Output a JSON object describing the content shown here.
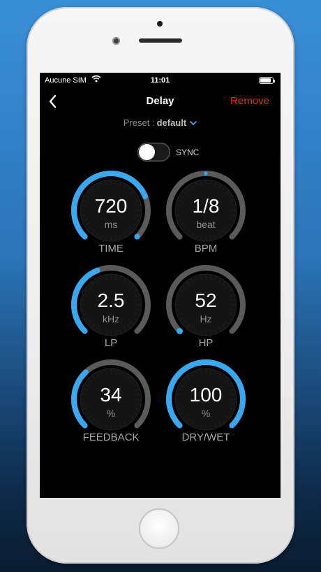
{
  "statusbar": {
    "carrier": "Aucune SIM",
    "time": "11:01"
  },
  "nav": {
    "title": "Delay",
    "remove_label": "Remove"
  },
  "preset": {
    "prefix": "Preset :",
    "value": "default"
  },
  "sync": {
    "label": "SYNC",
    "enabled": false
  },
  "colors": {
    "accent": "#3aa8f0",
    "track": "#5a5a5a",
    "remove": "#e8282b",
    "background": "#000000"
  },
  "knobs": [
    {
      "id": "time",
      "value": "720",
      "unit": "ms",
      "label": "TIME",
      "fraction": 0.75,
      "dot": "end"
    },
    {
      "id": "bpm",
      "value": "1/8",
      "unit": "beat",
      "label": "BPM",
      "fraction": 0.0,
      "dot": "top"
    },
    {
      "id": "lp",
      "value": "2.5",
      "unit": "kHz",
      "label": "LP",
      "fraction": 0.42
    },
    {
      "id": "hp",
      "value": "52",
      "unit": "Hz",
      "label": "HP",
      "fraction": 0.0,
      "dot": "start"
    },
    {
      "id": "feedback",
      "value": "34",
      "unit": "%",
      "label": "FEEDBACK",
      "fraction": 0.34
    },
    {
      "id": "drywet",
      "value": "100",
      "unit": "%",
      "label": "DRY/WET",
      "fraction": 1.0
    }
  ]
}
